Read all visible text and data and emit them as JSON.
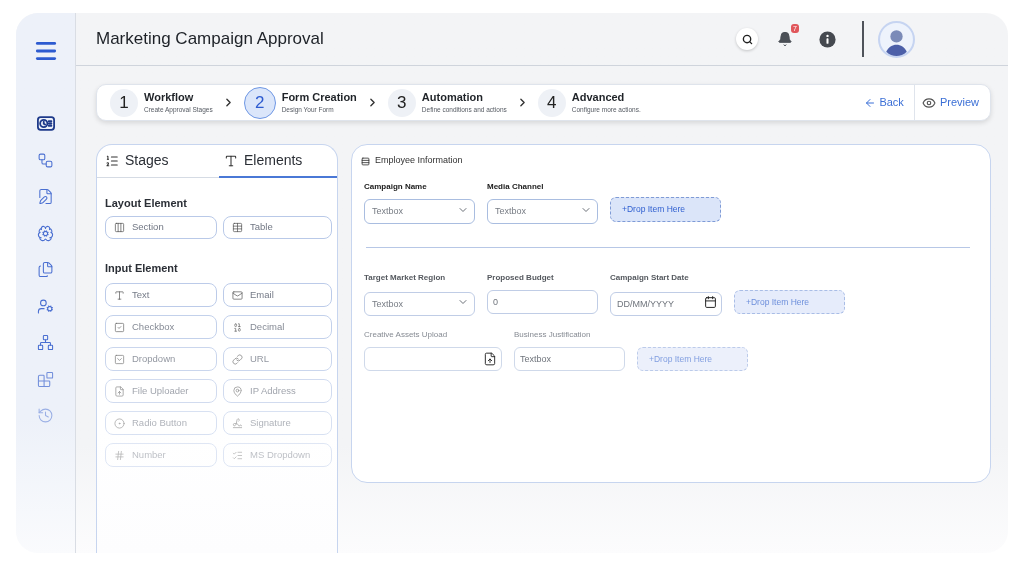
{
  "header": {
    "title": "Marketing Campaign Approval",
    "notification_count": "7"
  },
  "sidebar": {
    "items": [
      {
        "kind": "clock-card",
        "selected": true
      },
      {
        "kind": "workflow",
        "selected": false
      },
      {
        "kind": "file-edit",
        "selected": false
      },
      {
        "kind": "brain-gear",
        "selected": false
      },
      {
        "kind": "documents",
        "selected": false
      },
      {
        "kind": "user-gear",
        "selected": false
      },
      {
        "kind": "network",
        "selected": false
      },
      {
        "kind": "blocks",
        "selected": false
      },
      {
        "kind": "history",
        "selected": false
      }
    ]
  },
  "stepper": {
    "steps": [
      {
        "number": "1",
        "title": "Workflow",
        "subtitle": "Create Approval Stages",
        "selected": false
      },
      {
        "number": "2",
        "title": "Form Creation",
        "subtitle": "Design Your Form",
        "selected": true
      },
      {
        "number": "3",
        "title": "Automation",
        "subtitle": "Define conditions and actions",
        "selected": false
      },
      {
        "number": "4",
        "title": "Advanced",
        "subtitle": "Configure more actions.",
        "selected": false
      }
    ],
    "back": "Back",
    "preview": "Preview"
  },
  "palette": {
    "tabs": [
      {
        "kind": "stages",
        "label": "Stages",
        "selected": false
      },
      {
        "kind": "elements",
        "label": "Elements",
        "selected": true
      }
    ],
    "groups": [
      {
        "title": "Layout Element",
        "items": [
          {
            "kind": "section",
            "label": "Section"
          },
          {
            "kind": "table",
            "label": "Table"
          }
        ]
      },
      {
        "title": "Input Element",
        "items": [
          {
            "kind": "text",
            "label": "Text"
          },
          {
            "kind": "email",
            "label": "Email"
          },
          {
            "kind": "checkbox",
            "label": "Checkbox"
          },
          {
            "kind": "decimal",
            "label": "Decimal"
          },
          {
            "kind": "dropdown",
            "label": "Dropdown"
          },
          {
            "kind": "url",
            "label": "URL"
          },
          {
            "kind": "file_uploader",
            "label": "File Uploader"
          },
          {
            "kind": "ip_address",
            "label": "IP Address"
          },
          {
            "kind": "radio_button",
            "label": "Radio Button"
          },
          {
            "kind": "signature",
            "label": "Signature"
          },
          {
            "kind": "number",
            "label": "Number"
          },
          {
            "kind": "ms_dropdown",
            "label": "MS Dropdown"
          }
        ]
      }
    ]
  },
  "form": {
    "title": "Employee Information",
    "groups": [
      {
        "rows": [
          {
            "fields": [
              {
                "kind": "dropdown",
                "label": "Campaign Name",
                "placeholder": "Textbox"
              },
              {
                "kind": "dropdown",
                "label": "Media Channel",
                "placeholder": "Textbox"
              },
              {
                "kind": "drop_zone",
                "text": "+Drop Item Here"
              }
            ]
          }
        ]
      },
      {
        "rows": [
          {
            "fields": [
              {
                "kind": "dropdown",
                "label": "Target Market Region",
                "placeholder": "Textbox"
              },
              {
                "kind": "text",
                "label": "Proposed Budget",
                "placeholder": "0"
              },
              {
                "kind": "date",
                "label": "Campaign Start Date",
                "placeholder": "DD/MM/YYYY"
              },
              {
                "kind": "drop_zone",
                "text": "+Drop Item Here"
              }
            ]
          },
          {
            "fields": [
              {
                "kind": "upload",
                "label": "Creative Assets Upload"
              },
              {
                "kind": "text",
                "label": "Business Justification",
                "placeholder": "Textbox"
              },
              {
                "kind": "drop_zone",
                "text": "+Drop Item Here"
              }
            ]
          }
        ]
      }
    ]
  }
}
